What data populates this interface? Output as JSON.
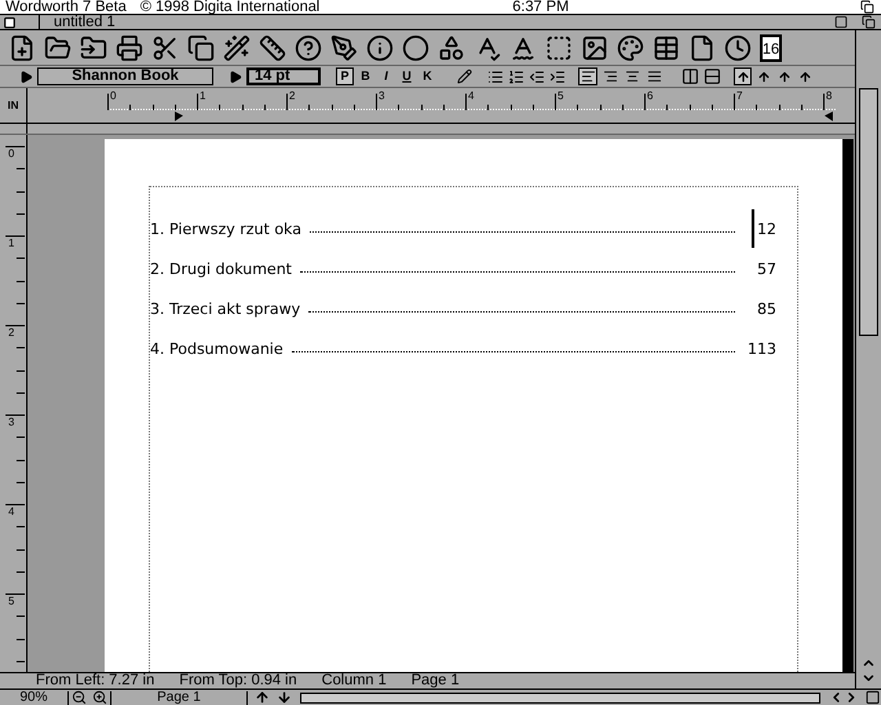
{
  "screen_title": {
    "app": "Wordworth 7 Beta",
    "copyright": "© 1998 Digita International",
    "clock": "6:37 PM"
  },
  "window": {
    "title": "untitled 1"
  },
  "toolbar": {
    "calendar_day": "16"
  },
  "format_bar": {
    "font": "Shannon Book",
    "size": "14 pt",
    "styles": [
      {
        "kind": "plain",
        "label": "P",
        "selected": true
      },
      {
        "kind": "bold",
        "label": "B",
        "selected": false
      },
      {
        "kind": "italic",
        "label": "I",
        "selected": false
      },
      {
        "kind": "underline",
        "label": "U",
        "selected": false
      },
      {
        "kind": "outline",
        "label": "K",
        "selected": false
      }
    ],
    "alignments": [
      {
        "kind": "left",
        "selected": true
      },
      {
        "kind": "right",
        "selected": false
      },
      {
        "kind": "center",
        "selected": false
      },
      {
        "kind": "justify",
        "selected": false
      }
    ],
    "spacing": [
      {
        "selected": true
      },
      {
        "selected": false
      },
      {
        "selected": false
      },
      {
        "selected": false
      }
    ]
  },
  "ruler": {
    "unit": "IN",
    "labels": [
      "0",
      "1",
      "2",
      "3",
      "4",
      "5",
      "6",
      "7",
      "8"
    ]
  },
  "vertical_ruler": {
    "labels": [
      "0",
      "1",
      "2",
      "3",
      "4",
      "5"
    ]
  },
  "toc": [
    {
      "title": "1. Pierwszy rzut oka",
      "page": "12"
    },
    {
      "title": "2. Drugi dokument",
      "page": "57"
    },
    {
      "title": "3. Trzeci akt sprawy",
      "page": "85"
    },
    {
      "title": "4. Podsumowanie",
      "page": "113"
    }
  ],
  "status_bar": [
    "From Left: 7.27 in",
    "From Top: 0.94 in",
    "Column 1",
    "Page 1"
  ],
  "bottom_bar": {
    "zoom": "90%",
    "page": "Page 1"
  }
}
